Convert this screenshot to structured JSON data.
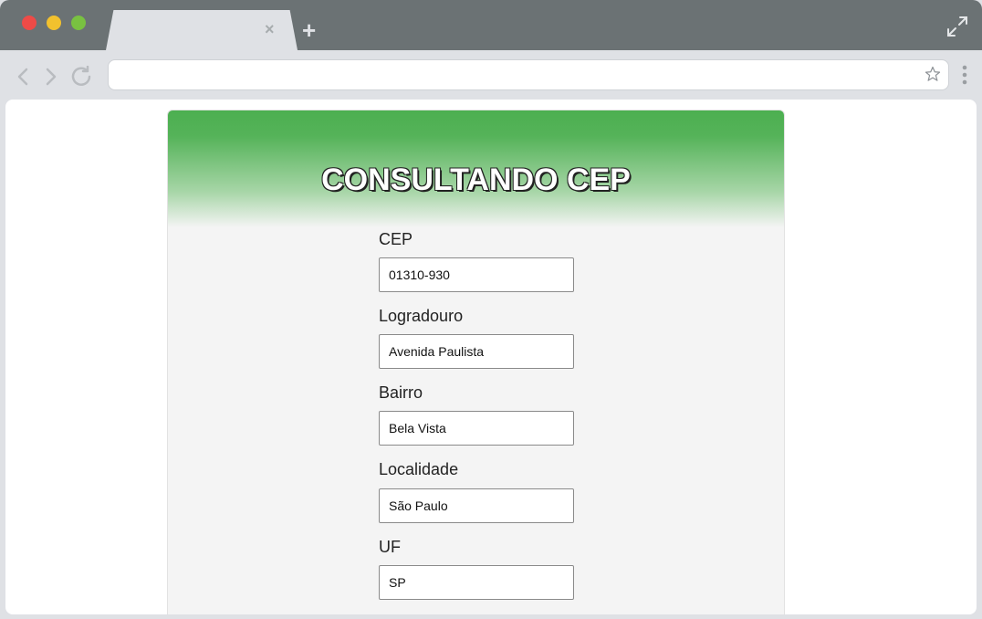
{
  "browser": {
    "tab_close": "×",
    "new_tab": "+",
    "address_value": "",
    "icons": [
      "close-icon",
      "plus-icon",
      "expand-icon",
      "back-icon",
      "forward-icon",
      "reload-icon",
      "star-icon",
      "menu-icon"
    ]
  },
  "page": {
    "title": "CONSULTANDO CEP",
    "header_color": "#4caf50",
    "fields": [
      {
        "label": "CEP",
        "value": "01310-930"
      },
      {
        "label": "Logradouro",
        "value": "Avenida Paulista"
      },
      {
        "label": "Bairro",
        "value": "Bela Vista"
      },
      {
        "label": "Localidade",
        "value": "São Paulo"
      },
      {
        "label": "UF",
        "value": "SP"
      }
    ]
  }
}
